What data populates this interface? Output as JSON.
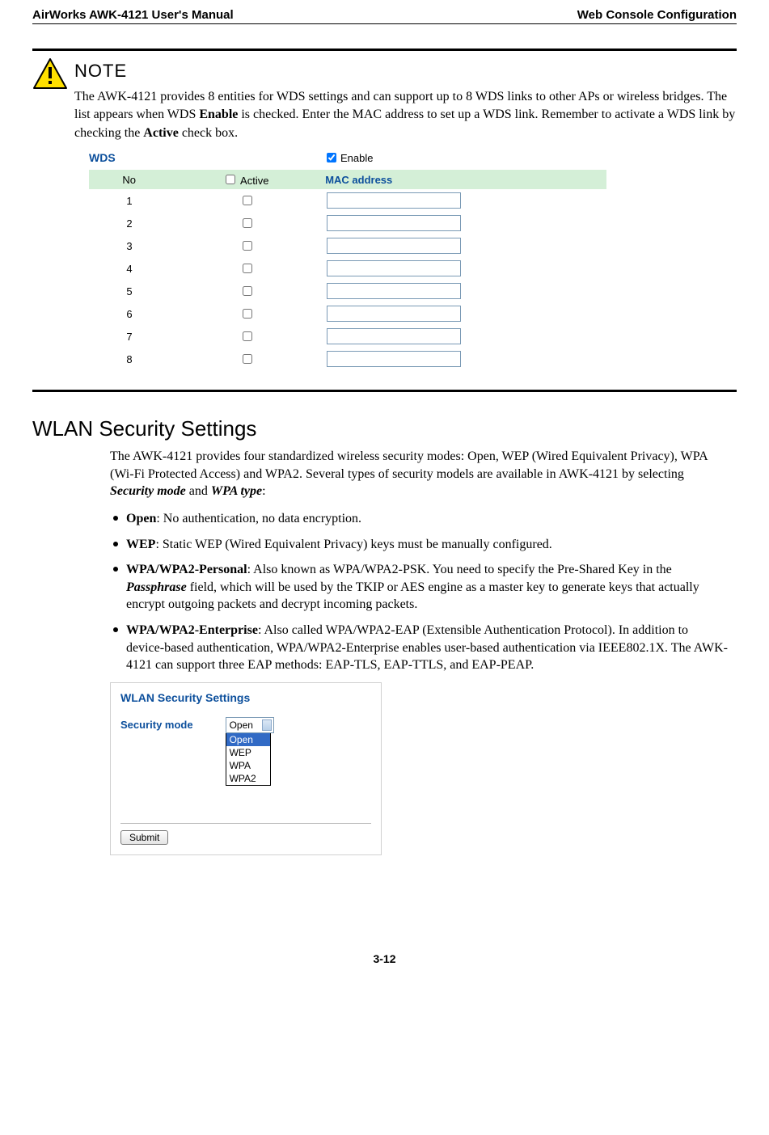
{
  "header": {
    "left": "AirWorks AWK-4121 User's Manual",
    "right": "Web Console Configuration"
  },
  "note": {
    "title": "NOTE",
    "paragraph_parts": {
      "p1a": "The AWK-4121 provides 8 entities for WDS settings and can support up to 8 WDS links to other APs or wireless bridges. The list appears when WDS ",
      "p1_enable": "Enable",
      "p1b": " is checked. Enter the MAC address to set up a WDS link. Remember to activate a WDS link by checking the ",
      "p1_active": "Active",
      "p1c": " check box."
    }
  },
  "wds": {
    "title": "WDS",
    "enable_label": "Enable",
    "col_no": "No",
    "col_active": "Active",
    "col_mac": "MAC address",
    "rows": [
      "1",
      "2",
      "3",
      "4",
      "5",
      "6",
      "7",
      "8"
    ]
  },
  "section": {
    "h2": "WLAN Security Settings",
    "intro_a": "The AWK-4121 provides four standardized wireless security modes: Open, WEP (Wired Equivalent Privacy), WPA (Wi-Fi Protected Access) and WPA2. Several types of security models are available in AWK-4121 by selecting ",
    "intro_sm": "Security mode",
    "intro_and": " and ",
    "intro_wpa": "WPA type",
    "intro_colon": ":",
    "bullets": {
      "b1_strong": "Open",
      "b1_rest": ": No authentication, no data encryption.",
      "b2_strong": "WEP",
      "b2_rest": ": Static WEP (Wired Equivalent Privacy) keys must be manually configured.",
      "b3_strong": "WPA/WPA2-Personal",
      "b3a": ": Also known as WPA/WPA2-PSK. You need to specify the Pre-Shared Key in the ",
      "b3_pass": "Passphrase",
      "b3b": " field, which will be used by the TKIP or AES engine as a master key to generate keys that actually encrypt outgoing packets and decrypt incoming packets.",
      "b4_strong": "WPA/WPA2-Enterprise",
      "b4_rest": ": Also called WPA/WPA2-EAP (Extensible Authentication Protocol). In addition to device-based authentication, WPA/WPA2-Enterprise enables user-based authentication via IEEE802.1X. The AWK-4121 can support three EAP methods: EAP-TLS, EAP-TTLS, and EAP-PEAP."
    }
  },
  "screenshot": {
    "title": "WLAN Security Settings",
    "label": "Security mode",
    "selected": "Open",
    "options": [
      "Open",
      "WEP",
      "WPA",
      "WPA2"
    ],
    "submit": "Submit"
  },
  "page_number": "3-12"
}
